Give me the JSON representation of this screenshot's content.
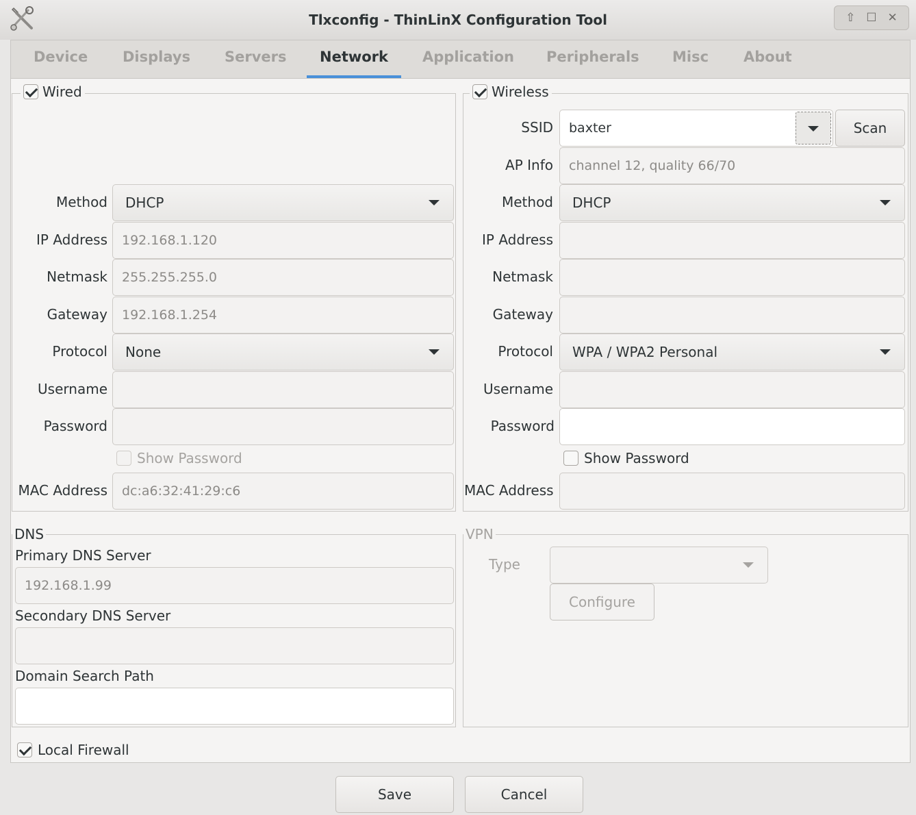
{
  "window": {
    "title": "Tlxconfig - ThinLinX Configuration Tool"
  },
  "tabs": [
    {
      "label": "Device"
    },
    {
      "label": "Displays"
    },
    {
      "label": "Servers"
    },
    {
      "label": "Network"
    },
    {
      "label": "Application"
    },
    {
      "label": "Peripherals"
    },
    {
      "label": "Misc"
    },
    {
      "label": "About"
    }
  ],
  "wired": {
    "label": "Wired",
    "checked": true,
    "method_label": "Method",
    "method_value": "DHCP",
    "ip_label": "IP Address",
    "ip_value": "192.168.1.120",
    "netmask_label": "Netmask",
    "netmask_value": "255.255.255.0",
    "gateway_label": "Gateway",
    "gateway_value": "192.168.1.254",
    "protocol_label": "Protocol",
    "protocol_value": "None",
    "username_label": "Username",
    "username_value": "",
    "password_label": "Password",
    "password_value": "",
    "show_password_label": "Show Password",
    "mac_label": "MAC Address",
    "mac_value": "dc:a6:32:41:29:c6"
  },
  "wireless": {
    "label": "Wireless",
    "checked": true,
    "ssid_label": "SSID",
    "ssid_value": "baxter",
    "scan_label": "Scan",
    "apinfo_label": "AP Info",
    "apinfo_value": "channel 12, quality 66/70",
    "method_label": "Method",
    "method_value": "DHCP",
    "ip_label": "IP Address",
    "ip_value": "",
    "netmask_label": "Netmask",
    "netmask_value": "",
    "gateway_label": "Gateway",
    "gateway_value": "",
    "protocol_label": "Protocol",
    "protocol_value": "WPA / WPA2 Personal",
    "username_label": "Username",
    "username_value": "",
    "password_label": "Password",
    "password_value": "",
    "show_password_label": "Show Password",
    "mac_label": "MAC Address",
    "mac_value": ""
  },
  "dns": {
    "label": "DNS",
    "primary_label": "Primary DNS Server",
    "primary_value": "192.168.1.99",
    "secondary_label": "Secondary DNS Server",
    "secondary_value": "",
    "search_label": "Domain Search Path",
    "search_value": ""
  },
  "vpn": {
    "label": "VPN",
    "type_label": "Type",
    "type_value": "",
    "configure_label": "Configure"
  },
  "firewall": {
    "label": "Local Firewall",
    "checked": true
  },
  "actions": {
    "save_label": "Save",
    "cancel_label": "Cancel"
  },
  "colors": {
    "accent": "#4a90d9",
    "background": "#e8e7e6",
    "panel": "#f5f4f3"
  },
  "icons": {
    "app": "tools-icon",
    "wm": [
      "keep-above-icon",
      "maximize-icon",
      "close-icon"
    ]
  }
}
